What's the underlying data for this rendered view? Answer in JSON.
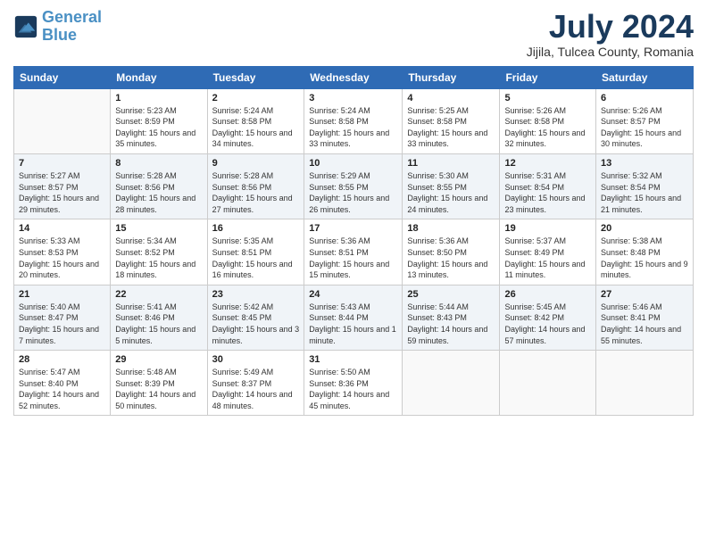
{
  "header": {
    "logo_line1": "General",
    "logo_line2": "Blue",
    "title": "July 2024",
    "subtitle": "Jijila, Tulcea County, Romania"
  },
  "columns": [
    "Sunday",
    "Monday",
    "Tuesday",
    "Wednesday",
    "Thursday",
    "Friday",
    "Saturday"
  ],
  "weeks": [
    [
      {
        "day": "",
        "empty": true
      },
      {
        "day": "1",
        "sunrise": "5:23 AM",
        "sunset": "8:59 PM",
        "daylight": "15 hours and 35 minutes."
      },
      {
        "day": "2",
        "sunrise": "5:24 AM",
        "sunset": "8:58 PM",
        "daylight": "15 hours and 34 minutes."
      },
      {
        "day": "3",
        "sunrise": "5:24 AM",
        "sunset": "8:58 PM",
        "daylight": "15 hours and 33 minutes."
      },
      {
        "day": "4",
        "sunrise": "5:25 AM",
        "sunset": "8:58 PM",
        "daylight": "15 hours and 33 minutes."
      },
      {
        "day": "5",
        "sunrise": "5:26 AM",
        "sunset": "8:58 PM",
        "daylight": "15 hours and 32 minutes."
      },
      {
        "day": "6",
        "sunrise": "5:26 AM",
        "sunset": "8:57 PM",
        "daylight": "15 hours and 30 minutes."
      }
    ],
    [
      {
        "day": "7",
        "sunrise": "5:27 AM",
        "sunset": "8:57 PM",
        "daylight": "15 hours and 29 minutes."
      },
      {
        "day": "8",
        "sunrise": "5:28 AM",
        "sunset": "8:56 PM",
        "daylight": "15 hours and 28 minutes."
      },
      {
        "day": "9",
        "sunrise": "5:28 AM",
        "sunset": "8:56 PM",
        "daylight": "15 hours and 27 minutes."
      },
      {
        "day": "10",
        "sunrise": "5:29 AM",
        "sunset": "8:55 PM",
        "daylight": "15 hours and 26 minutes."
      },
      {
        "day": "11",
        "sunrise": "5:30 AM",
        "sunset": "8:55 PM",
        "daylight": "15 hours and 24 minutes."
      },
      {
        "day": "12",
        "sunrise": "5:31 AM",
        "sunset": "8:54 PM",
        "daylight": "15 hours and 23 minutes."
      },
      {
        "day": "13",
        "sunrise": "5:32 AM",
        "sunset": "8:54 PM",
        "daylight": "15 hours and 21 minutes."
      }
    ],
    [
      {
        "day": "14",
        "sunrise": "5:33 AM",
        "sunset": "8:53 PM",
        "daylight": "15 hours and 20 minutes."
      },
      {
        "day": "15",
        "sunrise": "5:34 AM",
        "sunset": "8:52 PM",
        "daylight": "15 hours and 18 minutes."
      },
      {
        "day": "16",
        "sunrise": "5:35 AM",
        "sunset": "8:51 PM",
        "daylight": "15 hours and 16 minutes."
      },
      {
        "day": "17",
        "sunrise": "5:36 AM",
        "sunset": "8:51 PM",
        "daylight": "15 hours and 15 minutes."
      },
      {
        "day": "18",
        "sunrise": "5:36 AM",
        "sunset": "8:50 PM",
        "daylight": "15 hours and 13 minutes."
      },
      {
        "day": "19",
        "sunrise": "5:37 AM",
        "sunset": "8:49 PM",
        "daylight": "15 hours and 11 minutes."
      },
      {
        "day": "20",
        "sunrise": "5:38 AM",
        "sunset": "8:48 PM",
        "daylight": "15 hours and 9 minutes."
      }
    ],
    [
      {
        "day": "21",
        "sunrise": "5:40 AM",
        "sunset": "8:47 PM",
        "daylight": "15 hours and 7 minutes."
      },
      {
        "day": "22",
        "sunrise": "5:41 AM",
        "sunset": "8:46 PM",
        "daylight": "15 hours and 5 minutes."
      },
      {
        "day": "23",
        "sunrise": "5:42 AM",
        "sunset": "8:45 PM",
        "daylight": "15 hours and 3 minutes."
      },
      {
        "day": "24",
        "sunrise": "5:43 AM",
        "sunset": "8:44 PM",
        "daylight": "15 hours and 1 minute."
      },
      {
        "day": "25",
        "sunrise": "5:44 AM",
        "sunset": "8:43 PM",
        "daylight": "14 hours and 59 minutes."
      },
      {
        "day": "26",
        "sunrise": "5:45 AM",
        "sunset": "8:42 PM",
        "daylight": "14 hours and 57 minutes."
      },
      {
        "day": "27",
        "sunrise": "5:46 AM",
        "sunset": "8:41 PM",
        "daylight": "14 hours and 55 minutes."
      }
    ],
    [
      {
        "day": "28",
        "sunrise": "5:47 AM",
        "sunset": "8:40 PM",
        "daylight": "14 hours and 52 minutes."
      },
      {
        "day": "29",
        "sunrise": "5:48 AM",
        "sunset": "8:39 PM",
        "daylight": "14 hours and 50 minutes."
      },
      {
        "day": "30",
        "sunrise": "5:49 AM",
        "sunset": "8:37 PM",
        "daylight": "14 hours and 48 minutes."
      },
      {
        "day": "31",
        "sunrise": "5:50 AM",
        "sunset": "8:36 PM",
        "daylight": "14 hours and 45 minutes."
      },
      {
        "day": "",
        "empty": true
      },
      {
        "day": "",
        "empty": true
      },
      {
        "day": "",
        "empty": true
      }
    ]
  ]
}
